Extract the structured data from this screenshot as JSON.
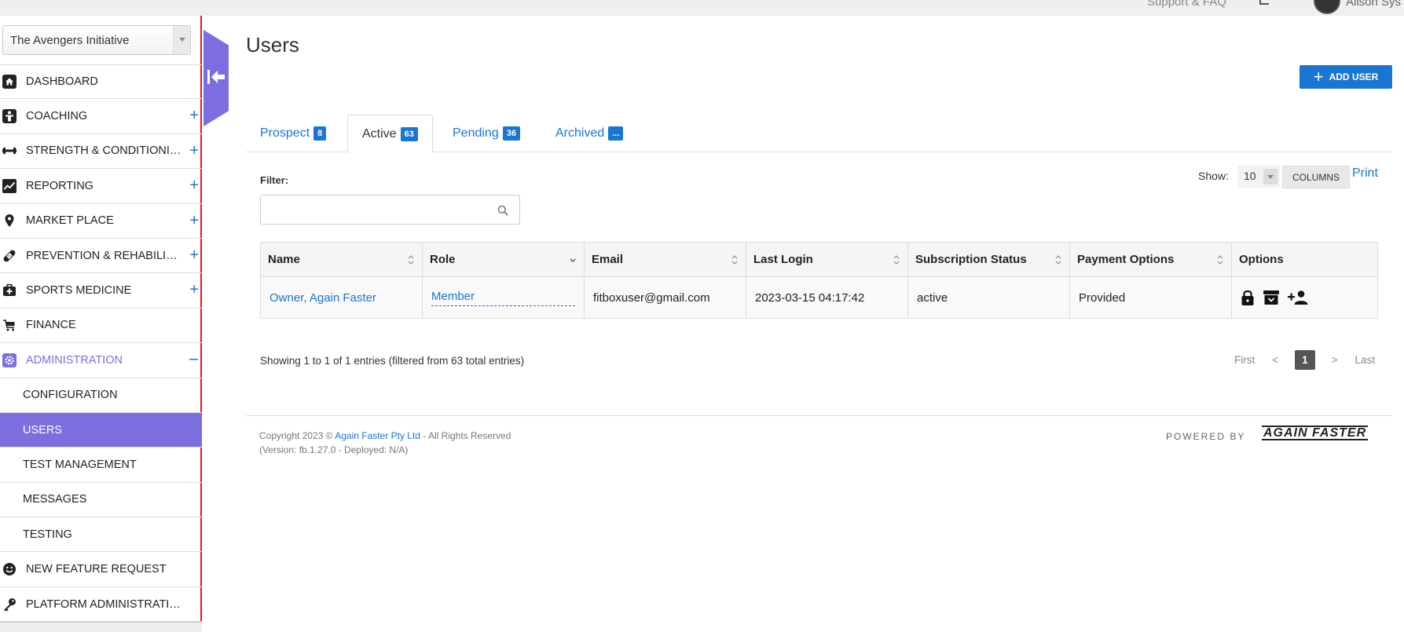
{
  "topbar": {
    "support_label": "Support & FAQ",
    "username": "Alison Sys"
  },
  "sidebar": {
    "org_select": "The Avengers Initiative",
    "items": [
      {
        "label": "DASHBOARD",
        "icon": "home-icon",
        "expand": ""
      },
      {
        "label": "COACHING",
        "icon": "person-icon",
        "expand": "+"
      },
      {
        "label": "STRENGTH & CONDITIONING",
        "icon": "dumbbell-icon",
        "expand": "+"
      },
      {
        "label": "REPORTING",
        "icon": "chart-icon",
        "expand": "+"
      },
      {
        "label": "MARKET PLACE",
        "icon": "location-pin-icon",
        "expand": "+"
      },
      {
        "label": "PREVENTION & REHABILITATION",
        "icon": "bandage-icon",
        "expand": "+"
      },
      {
        "label": "SPORTS MEDICINE",
        "icon": "medkit-icon",
        "expand": "+"
      },
      {
        "label": "FINANCE",
        "icon": "cart-icon",
        "expand": ""
      },
      {
        "label": "ADMINISTRATION",
        "icon": "gear-icon",
        "expand": "−"
      }
    ],
    "sub_items": [
      {
        "label": "CONFIGURATION"
      },
      {
        "label": "USERS"
      },
      {
        "label": "TEST MANAGEMENT"
      },
      {
        "label": "MESSAGES"
      },
      {
        "label": "TESTING"
      }
    ],
    "bottom_items": [
      {
        "label": "NEW FEATURE REQUEST",
        "icon": "smiley-icon"
      },
      {
        "label": "PLATFORM ADMINISTRATION",
        "icon": "key-icon"
      }
    ]
  },
  "page": {
    "title": "Users",
    "add_user_label": "ADD USER"
  },
  "tabs": [
    {
      "label": "Prospect",
      "count": "8"
    },
    {
      "label": "Active",
      "count": "63"
    },
    {
      "label": "Pending",
      "count": "36"
    },
    {
      "label": "Archived",
      "count": "..."
    }
  ],
  "filter": {
    "label": "Filter:",
    "value": "",
    "placeholder": ""
  },
  "controls": {
    "show_label": "Show:",
    "page_size": "10",
    "columns_label": "COLUMNS",
    "print_label": "Print"
  },
  "table": {
    "headers": [
      "Name",
      "Role",
      "Email",
      "Last Login",
      "Subscription Status",
      "Payment Options",
      "Options"
    ],
    "rows": [
      {
        "name": "Owner, Again Faster",
        "role": "Member",
        "email": "fitboxuser@gmail.com",
        "last_login": "2023-03-15 04:17:42",
        "subscription_status": "active",
        "payment_options": "Provided"
      }
    ]
  },
  "pagination": {
    "info": "Showing 1 to 1 of 1 entries (filtered from 63 total entries)",
    "first": "First",
    "prev": "<",
    "current": "1",
    "next": ">",
    "last": "Last"
  },
  "footer": {
    "copyright_prefix": "Copyright 2023 ©",
    "company": "Again Faster Pty Ltd",
    "rights": "- All Rights Reserved",
    "version": "(Version: fb.1.27.0 - Deployed: N/A)",
    "powered_by": "POWERED BY",
    "brand": "AGAIN FASTER"
  },
  "colors": {
    "accent": "#7b6fe0",
    "primary": "#1976d2",
    "sidebar_border": "#e0191f"
  }
}
